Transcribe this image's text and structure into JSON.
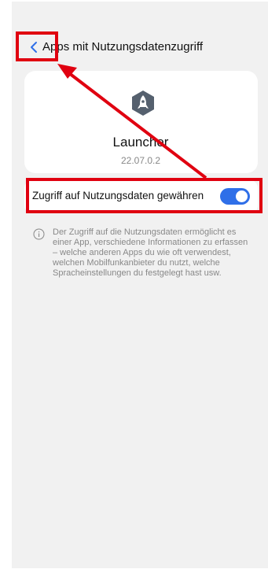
{
  "header": {
    "back_icon": "chevron-left-icon",
    "title": "Apps mit Nutzungsdatenzugriff"
  },
  "app": {
    "icon": "launcher-rocket-icon",
    "name": "Launcher",
    "version": "22.07.0.2"
  },
  "permission": {
    "label": "Zugriff auf Nutzungsdaten gewähren",
    "enabled": true
  },
  "info": {
    "icon": "info-circle-icon",
    "text": "Der Zugriff auf die Nutzungsdaten ermöglicht es einer App, verschiedene Informationen zu erfassen – welche anderen Apps du wie oft verwendest, welchen Mobilfunkanbieter du nutzt, welche Spracheinstellungen du festgelegt hast usw."
  },
  "colors": {
    "accent": "#2f6fe8",
    "annotation": "#e00010",
    "background": "#f1f1f1"
  }
}
